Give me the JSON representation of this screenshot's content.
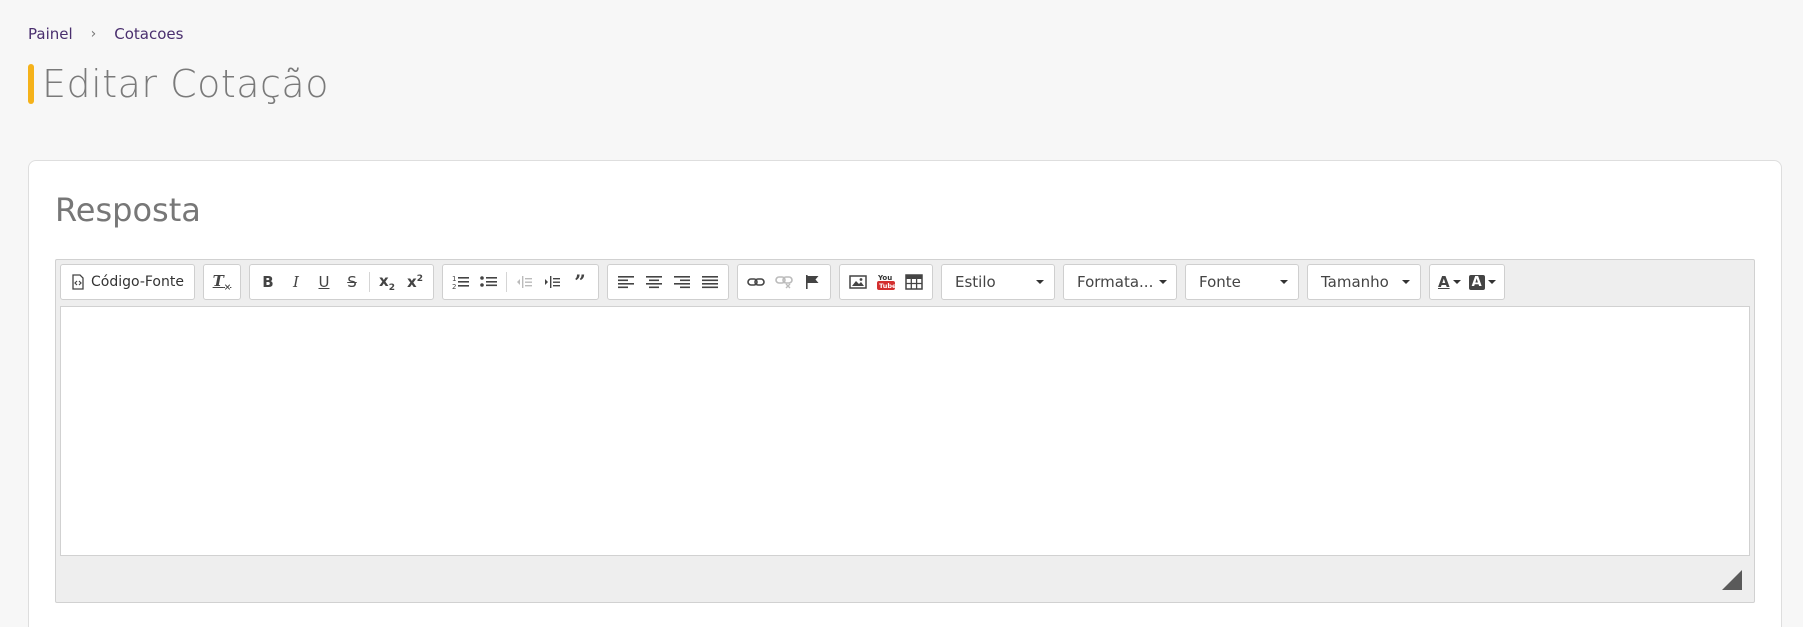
{
  "breadcrumb": {
    "home": "Painel",
    "separator": "›",
    "current": "Cotacoes"
  },
  "page": {
    "title": "Editar Cotação"
  },
  "card": {
    "title": "Resposta"
  },
  "editor": {
    "source_label": "Código-Fonte",
    "combos": {
      "style": "Estilo",
      "format": "Formata...",
      "font": "Fonte",
      "size": "Tamanho"
    },
    "icons": [
      "source-icon",
      "remove-format-icon",
      "bold-icon",
      "italic-icon",
      "underline-icon",
      "strikethrough-icon",
      "subscript-icon",
      "superscript-icon",
      "numbered-list-icon",
      "bulleted-list-icon",
      "outdent-icon",
      "indent-icon",
      "blockquote-icon",
      "align-left-icon",
      "align-center-icon",
      "align-right-icon",
      "justify-icon",
      "link-icon",
      "unlink-icon",
      "anchor-icon",
      "image-icon",
      "youtube-icon",
      "table-icon",
      "text-color-icon",
      "background-color-icon",
      "resize-handle-icon"
    ],
    "content": ""
  },
  "colors": {
    "accent": "#f5b21a",
    "breadcrumb": "#4a2f6e",
    "title": "#7a7a7a"
  }
}
